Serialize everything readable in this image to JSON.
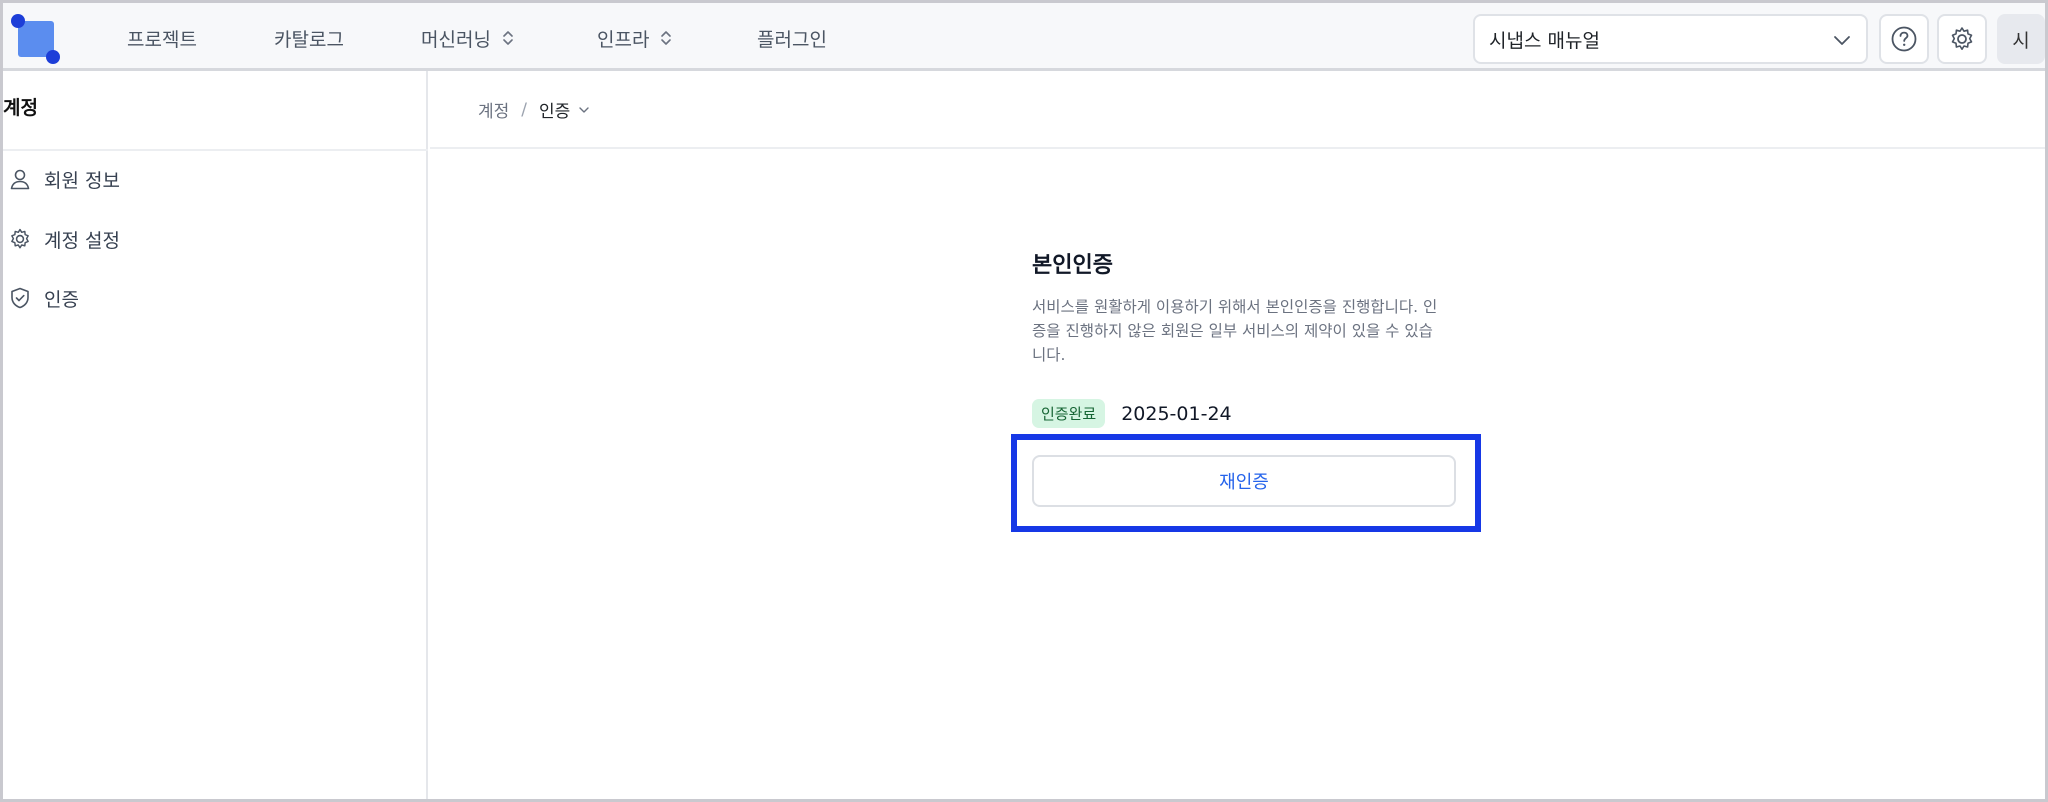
{
  "topbar": {
    "nav": [
      {
        "label": "프로젝트"
      },
      {
        "label": "카탈로그"
      },
      {
        "label": "머신러닝"
      },
      {
        "label": "인프라"
      },
      {
        "label": "플러그인"
      }
    ],
    "manual_select_value": "시냅스 매뉴얼",
    "avatar_initial": "시"
  },
  "sidebar": {
    "title": "계정",
    "items": [
      {
        "label": "회원 정보",
        "icon": "user-icon"
      },
      {
        "label": "계정 설정",
        "icon": "gear-icon"
      },
      {
        "label": "인증",
        "icon": "shield-check-icon"
      }
    ]
  },
  "breadcrumb": {
    "root": "계정",
    "separator": "/",
    "current": "인증"
  },
  "verification": {
    "title": "본인인증",
    "description": "서비스를 원활하게 이용하기 위해서 본인인증을 진행합니다. 인증을 진행하지 않은 회원은 일부 서비스의 제약이 있을 수 있습니다.",
    "status_badge": "인증완료",
    "date": "2025-01-24",
    "reauth_label": "재인증"
  },
  "colors": {
    "accent": "#2563eb",
    "highlight": "#1638e6",
    "badge_bg": "#d6f5e3",
    "badge_text": "#166534"
  }
}
